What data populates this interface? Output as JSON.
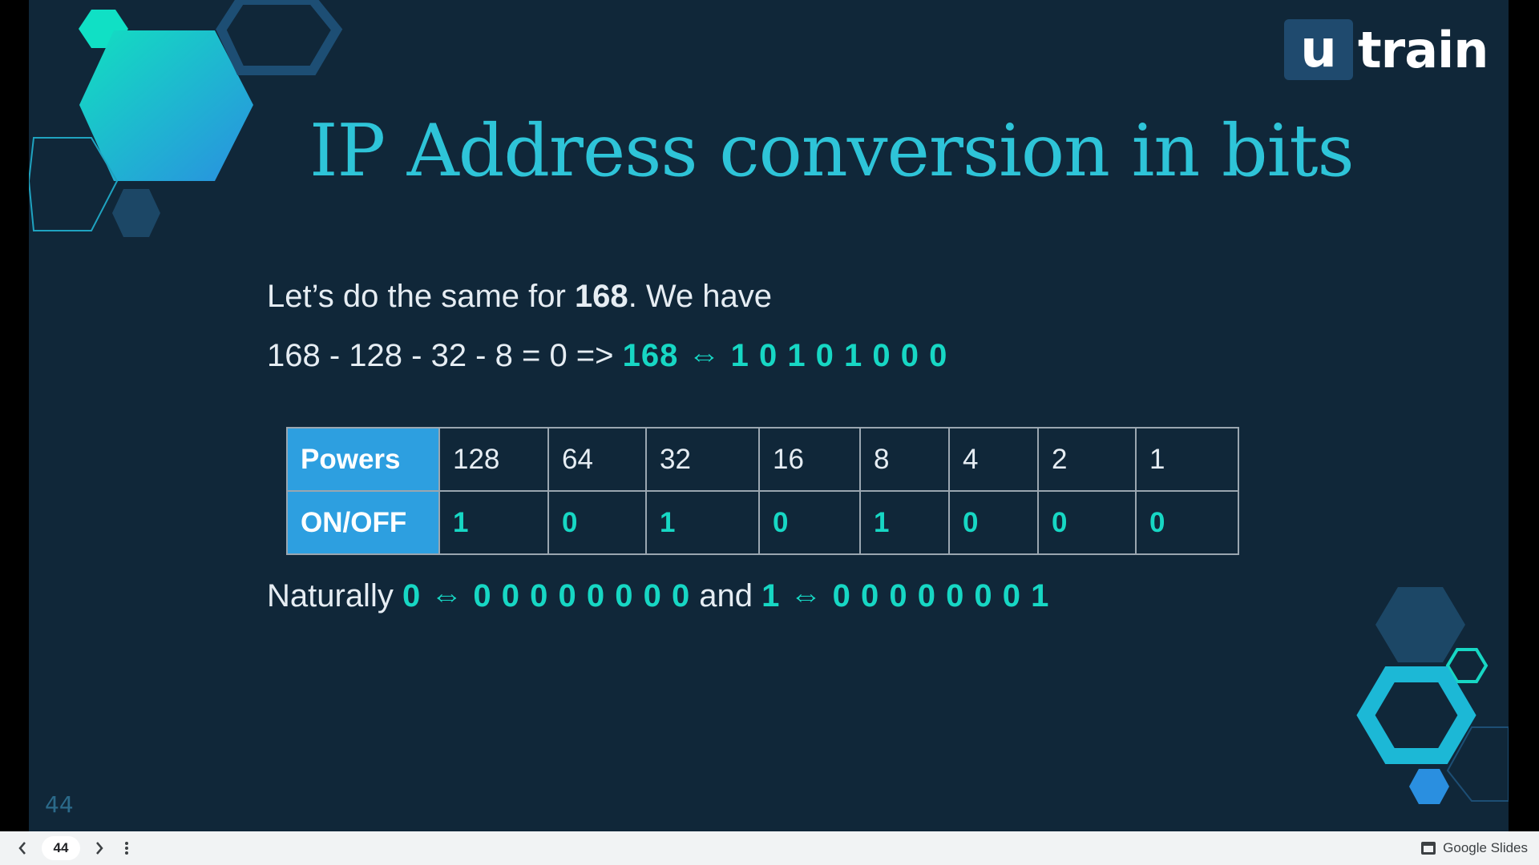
{
  "slide": {
    "logo": {
      "badge": "u",
      "text": "train"
    },
    "title": "IP Address conversion in bits",
    "line1": {
      "prefix": "Let’s do the same for ",
      "bold": "168",
      "suffix": ". We have"
    },
    "line2": {
      "equation": "168 - 128 - 32 - 8 = 0 => ",
      "result": "168 ⇔ 1 0 1 0 1 0 0 0"
    },
    "table": {
      "row1_header": "Powers",
      "powers": [
        "128",
        "64",
        "32",
        "16",
        "8",
        "4",
        "2",
        "1"
      ],
      "row2_header": "ON/OFF",
      "bits": [
        "1",
        "0",
        "1",
        "0",
        "1",
        "0",
        "0",
        "0"
      ]
    },
    "line3": {
      "prefix": "Naturally ",
      "first": "0 ⇔ 0 0 0 0 0 0 0 0",
      "middle": " and ",
      "second": "1 ⇔ 0 0 0 0 0 0 0 1"
    },
    "page_number": "44"
  },
  "toolbar": {
    "prev_icon": "chevron-left-icon",
    "page": "44",
    "next_icon": "chevron-right-icon",
    "menu_icon": "more-vertical-icon",
    "brand": "Google Slides"
  },
  "colors": {
    "slide_bg": "#102739",
    "accent_teal": "#17d7c4",
    "title": "#2ec4d8",
    "table_header": "#2d9fe0"
  }
}
